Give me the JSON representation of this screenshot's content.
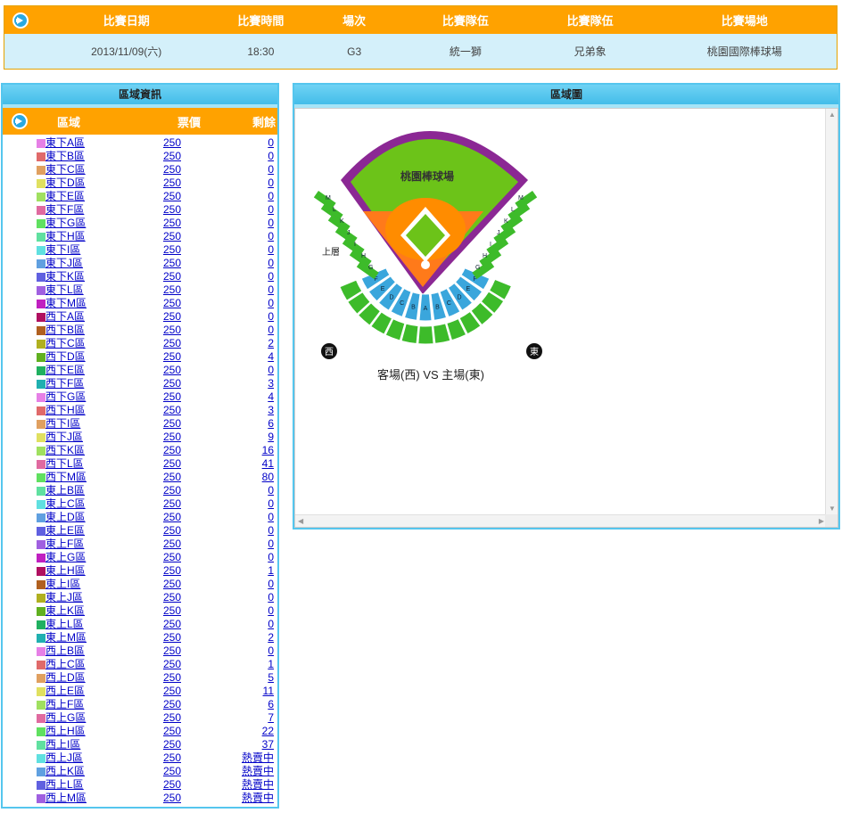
{
  "game": {
    "headers": [
      "比賽日期",
      "比賽時間",
      "場次",
      "比賽隊伍",
      "比賽隊伍",
      "比賽場地"
    ],
    "date": "2013/11/09(六)",
    "time": "18:30",
    "game_no": "G3",
    "team1": "統一獅",
    "team2": "兄弟象",
    "venue": "桃園國際棒球場"
  },
  "zone_panel": {
    "title": "區域資訊",
    "col_zone": "區域",
    "col_price": "票價",
    "col_left": "剩餘"
  },
  "map_panel": {
    "title": "區域圖",
    "stadium_name": "桃園棒球場",
    "upper_label": "上層",
    "west": "西",
    "east": "東",
    "caption": "客場(西) VS 主場(東)",
    "section_letters_upper_west": [
      "M",
      "L",
      "K",
      "J",
      "I",
      "H",
      "G"
    ],
    "section_letters_upper_east": [
      "M",
      "L",
      "K",
      "J",
      "I",
      "H",
      "G"
    ],
    "section_letters_lower": [
      "F",
      "E",
      "D",
      "C",
      "B",
      "A",
      "B",
      "C",
      "D",
      "E",
      "F"
    ],
    "colors": {
      "field": "#6cc319",
      "infield": "#ff8c00",
      "wall": "#8b2894",
      "lower": "#3aa6dc",
      "upper": "#3dbb2a"
    }
  },
  "zones": [
    {
      "name": "東下A區",
      "price": "250",
      "left": "0",
      "color": "#e680e6"
    },
    {
      "name": "東下B區",
      "price": "250",
      "left": "0",
      "color": "#e06a6a"
    },
    {
      "name": "東下C區",
      "price": "250",
      "left": "0",
      "color": "#e0a060"
    },
    {
      "name": "東下D區",
      "price": "250",
      "left": "0",
      "color": "#e0e060"
    },
    {
      "name": "東下E區",
      "price": "250",
      "left": "0",
      "color": "#a0e060"
    },
    {
      "name": "東下F區",
      "price": "250",
      "left": "0",
      "color": "#e06aa0"
    },
    {
      "name": "東下G區",
      "price": "250",
      "left": "0",
      "color": "#60e060"
    },
    {
      "name": "東下H區",
      "price": "250",
      "left": "0",
      "color": "#60e0a0"
    },
    {
      "name": "東下I區",
      "price": "250",
      "left": "0",
      "color": "#60e0e0"
    },
    {
      "name": "東下J區",
      "price": "250",
      "left": "0",
      "color": "#60a0e0"
    },
    {
      "name": "東下K區",
      "price": "250",
      "left": "0",
      "color": "#6060e0"
    },
    {
      "name": "東下L區",
      "price": "250",
      "left": "0",
      "color": "#a060e0"
    },
    {
      "name": "東下M區",
      "price": "250",
      "left": "0",
      "color": "#c020c0"
    },
    {
      "name": "西下A區",
      "price": "250",
      "left": "0",
      "color": "#b01060"
    },
    {
      "name": "西下B區",
      "price": "250",
      "left": "0",
      "color": "#b06020"
    },
    {
      "name": "西下C區",
      "price": "250",
      "left": "2",
      "color": "#b0b020"
    },
    {
      "name": "西下D區",
      "price": "250",
      "left": "4",
      "color": "#60b020"
    },
    {
      "name": "西下E區",
      "price": "250",
      "left": "0",
      "color": "#20b060"
    },
    {
      "name": "西下F區",
      "price": "250",
      "left": "3",
      "color": "#20b0b0"
    },
    {
      "name": "西下G區",
      "price": "250",
      "left": "4",
      "color": "#e680e6"
    },
    {
      "name": "西下H區",
      "price": "250",
      "left": "3",
      "color": "#e06a6a"
    },
    {
      "name": "西下I區",
      "price": "250",
      "left": "6",
      "color": "#e0a060"
    },
    {
      "name": "西下J區",
      "price": "250",
      "left": "9",
      "color": "#e0e060"
    },
    {
      "name": "西下K區",
      "price": "250",
      "left": "16",
      "color": "#a0e060"
    },
    {
      "name": "西下L區",
      "price": "250",
      "left": "41",
      "color": "#e06aa0"
    },
    {
      "name": "西下M區",
      "price": "250",
      "left": "80",
      "color": "#60e060"
    },
    {
      "name": "東上B區",
      "price": "250",
      "left": "0",
      "color": "#60e0a0"
    },
    {
      "name": "東上C區",
      "price": "250",
      "left": "0",
      "color": "#60e0e0"
    },
    {
      "name": "東上D區",
      "price": "250",
      "left": "0",
      "color": "#60a0e0"
    },
    {
      "name": "東上E區",
      "price": "250",
      "left": "0",
      "color": "#6060e0"
    },
    {
      "name": "東上F區",
      "price": "250",
      "left": "0",
      "color": "#a060e0"
    },
    {
      "name": "東上G區",
      "price": "250",
      "left": "0",
      "color": "#c020c0"
    },
    {
      "name": "東上H區",
      "price": "250",
      "left": "1",
      "color": "#b01060"
    },
    {
      "name": "東上I區",
      "price": "250",
      "left": "0",
      "color": "#b06020"
    },
    {
      "name": "東上J區",
      "price": "250",
      "left": "0",
      "color": "#b0b020"
    },
    {
      "name": "東上K區",
      "price": "250",
      "left": "0",
      "color": "#60b020"
    },
    {
      "name": "東上L區",
      "price": "250",
      "left": "0",
      "color": "#20b060"
    },
    {
      "name": "東上M區",
      "price": "250",
      "left": "2",
      "color": "#20b0b0"
    },
    {
      "name": "西上B區",
      "price": "250",
      "left": "0",
      "color": "#e680e6"
    },
    {
      "name": "西上C區",
      "price": "250",
      "left": "1",
      "color": "#e06a6a"
    },
    {
      "name": "西上D區",
      "price": "250",
      "left": "5",
      "color": "#e0a060"
    },
    {
      "name": "西上E區",
      "price": "250",
      "left": "11",
      "color": "#e0e060"
    },
    {
      "name": "西上F區",
      "price": "250",
      "left": "6",
      "color": "#a0e060"
    },
    {
      "name": "西上G區",
      "price": "250",
      "left": "7",
      "color": "#e06aa0"
    },
    {
      "name": "西上H區",
      "price": "250",
      "left": "22",
      "color": "#60e060"
    },
    {
      "name": "西上I區",
      "price": "250",
      "left": "37",
      "color": "#60e0a0"
    },
    {
      "name": "西上J區",
      "price": "250",
      "left": "熱賣中",
      "color": "#60e0e0"
    },
    {
      "name": "西上K區",
      "price": "250",
      "left": "熱賣中",
      "color": "#60a0e0"
    },
    {
      "name": "西上L區",
      "price": "250",
      "left": "熱賣中",
      "color": "#6060e0"
    },
    {
      "name": "西上M區",
      "price": "250",
      "left": "熱賣中",
      "color": "#a060e0"
    }
  ]
}
